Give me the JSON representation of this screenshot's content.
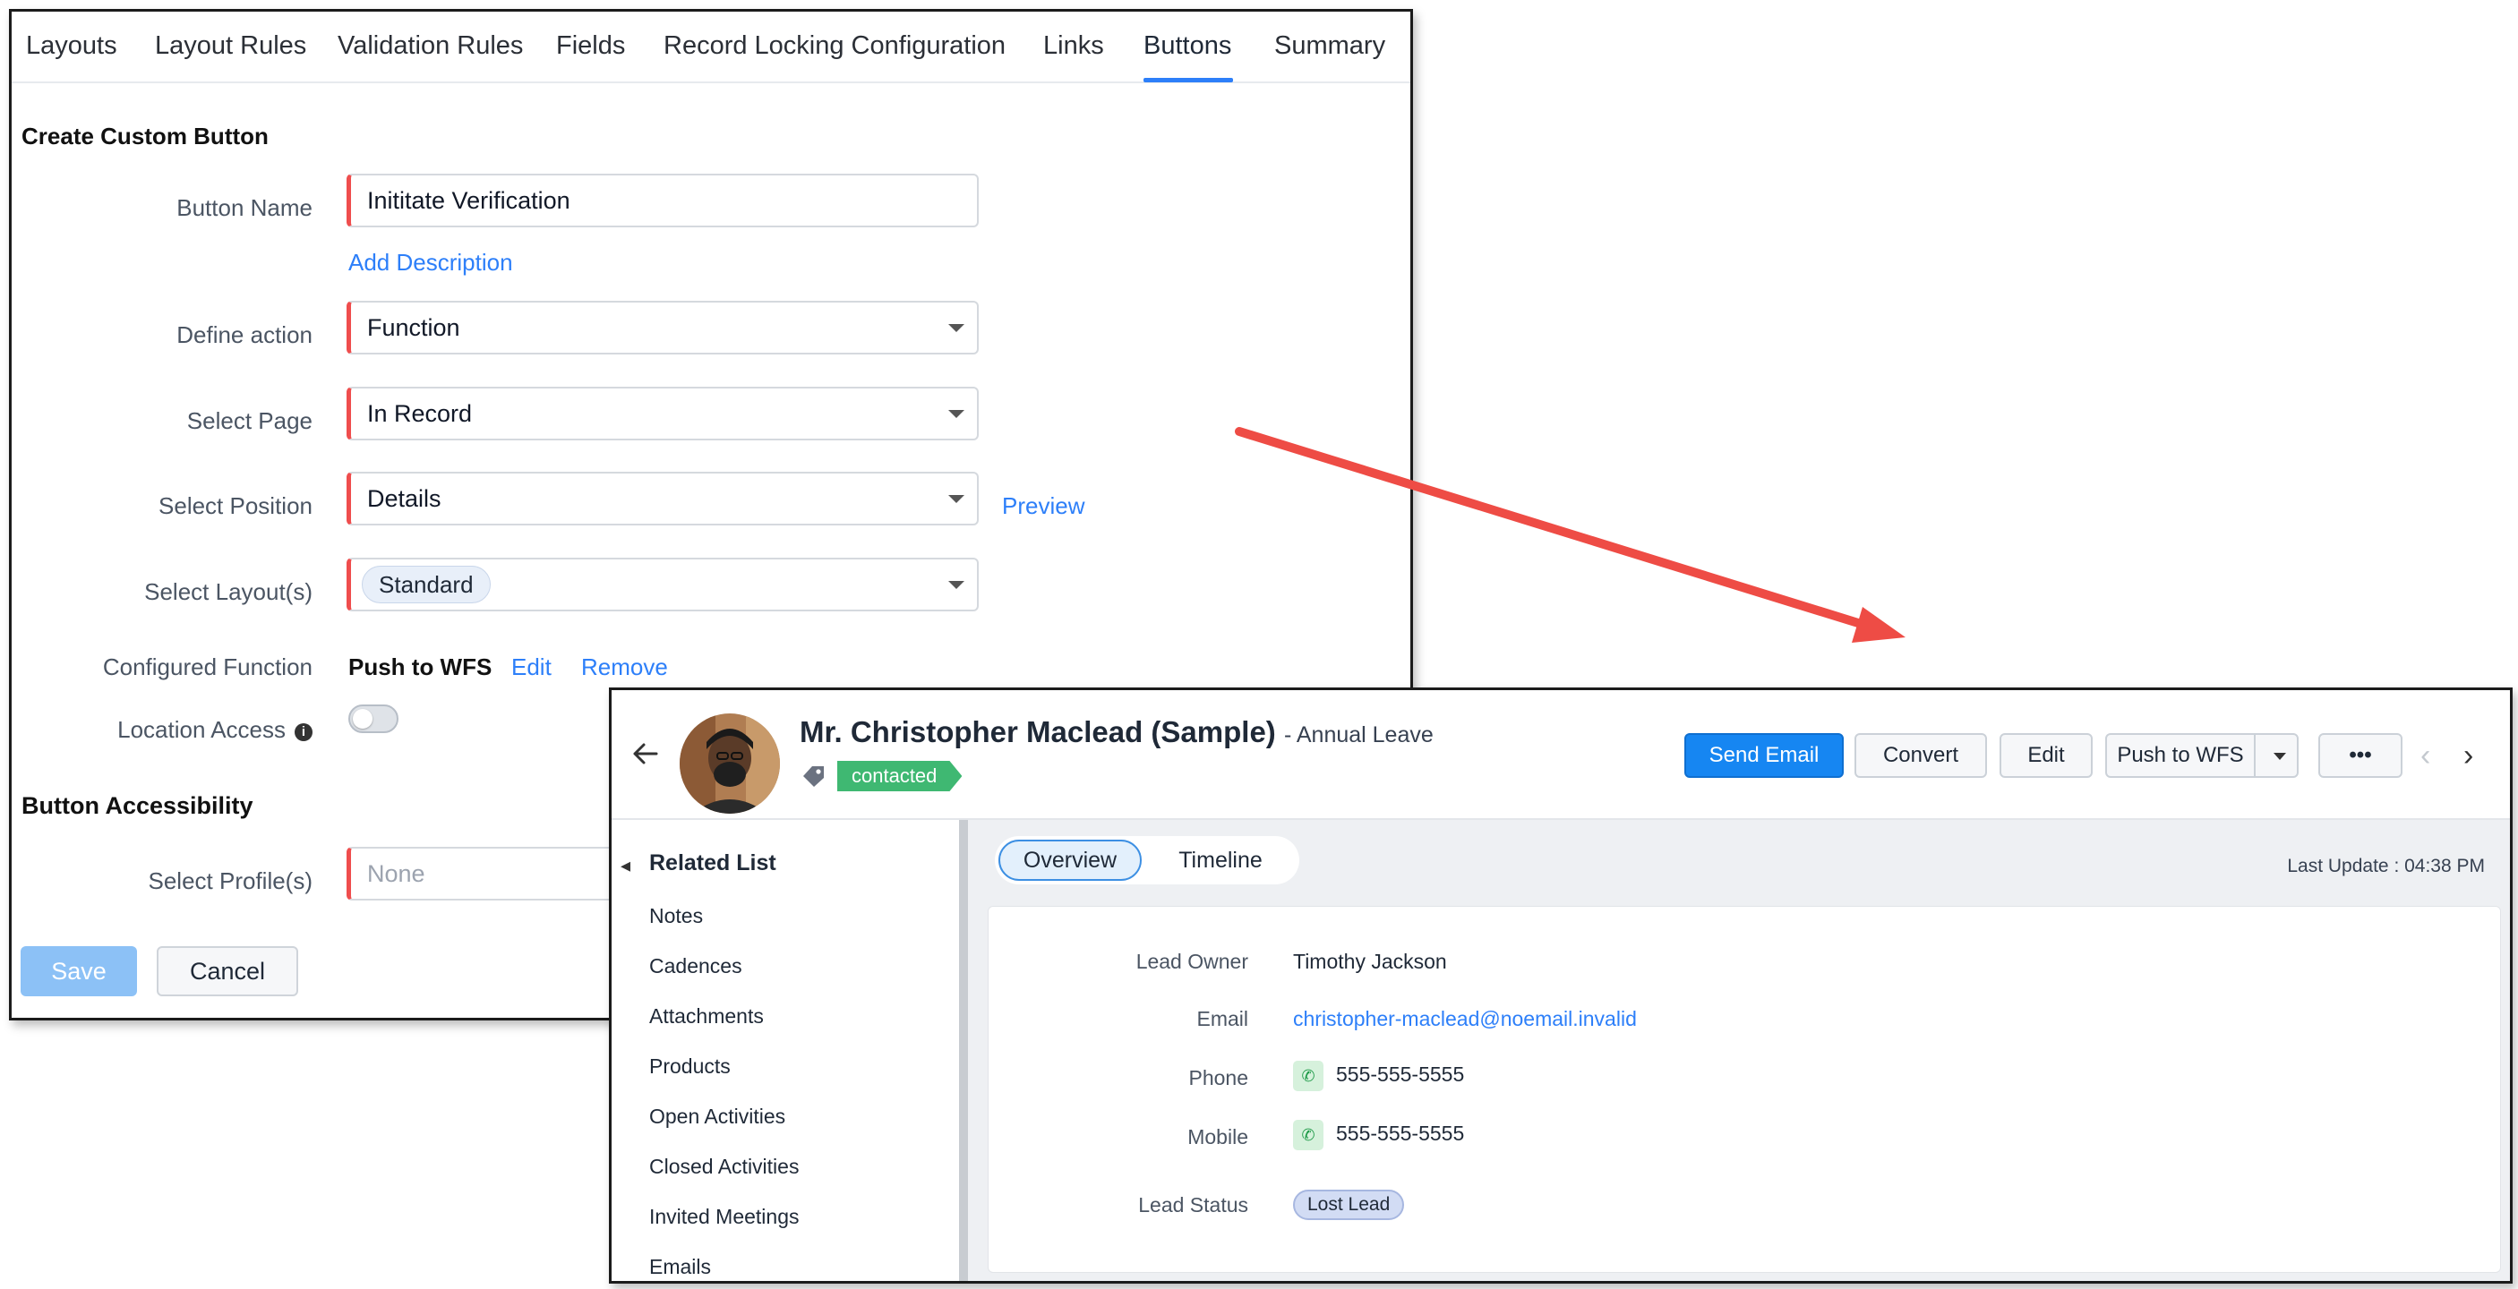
{
  "tabs": [
    "Layouts",
    "Layout Rules",
    "Validation Rules",
    "Fields",
    "Record Locking Configuration",
    "Links",
    "Buttons",
    "Summary"
  ],
  "active_tab": "Buttons",
  "form": {
    "section_title": "Create Custom Button",
    "button_name_label": "Button Name",
    "button_name_value": "Inititate Verification",
    "add_description": "Add Description",
    "define_action_label": "Define action",
    "define_action_value": "Function",
    "select_page_label": "Select Page",
    "select_page_value": "In Record",
    "select_position_label": "Select Position",
    "select_position_value": "Details",
    "preview_link": "Preview",
    "select_layouts_label": "Select Layout(s)",
    "select_layouts_chip": "Standard",
    "configured_function_label": "Configured Function",
    "configured_function_value": "Push to WFS",
    "edit_link": "Edit",
    "remove_link": "Remove",
    "location_access_label": "Location Access",
    "location_access_enabled": false,
    "accessibility_title": "Button Accessibility",
    "select_profiles_label": "Select Profile(s)",
    "select_profiles_placeholder": "None",
    "save_label": "Save",
    "cancel_label": "Cancel"
  },
  "record": {
    "name": "Mr. Christopher Maclead (Sample)",
    "subtitle": "- Annual Leave",
    "status_tag": "contacted",
    "buttons": {
      "send_email": "Send Email",
      "convert": "Convert",
      "edit": "Edit",
      "push_to_wfs": "Push to WFS",
      "more": "•••"
    },
    "sidebar": {
      "title": "Related List",
      "items": [
        "Notes",
        "Cadences",
        "Attachments",
        "Products",
        "Open Activities",
        "Closed Activities",
        "Invited Meetings",
        "Emails"
      ]
    },
    "view_tabs": {
      "overview": "Overview",
      "timeline": "Timeline"
    },
    "last_update": "Last Update : 04:38 PM",
    "details": {
      "lead_owner_label": "Lead Owner",
      "lead_owner_value": "Timothy Jackson",
      "email_label": "Email",
      "email_value": "christopher-maclead@noemail.invalid",
      "phone_label": "Phone",
      "phone_value": "555-555-5555",
      "mobile_label": "Mobile",
      "mobile_value": "555-555-5555",
      "lead_status_label": "Lead Status",
      "lead_status_value": "Lost Lead"
    }
  },
  "colors": {
    "accent": "#2d7ff9",
    "required_marker": "#ef4d4d",
    "arrow": "#ee4c45",
    "primary_button": "#1686f2",
    "status_tag": "#3fb872"
  }
}
